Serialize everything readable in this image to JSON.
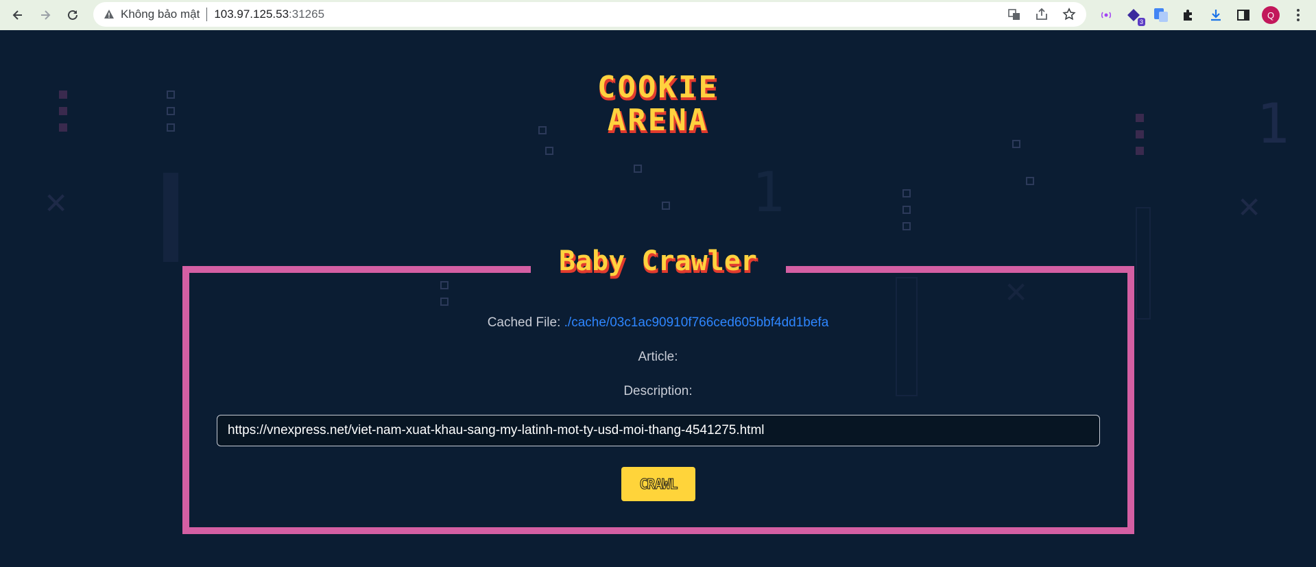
{
  "browser": {
    "security_label": "Không bảo mật",
    "url_host": "103.97.125.53",
    "url_port": ":31265",
    "extension_badge": "3",
    "profile_initial": "Q"
  },
  "page": {
    "logo_line1": "COOKIE",
    "logo_line2": "ARENA",
    "title": "Baby Crawler",
    "cached_file_label": "Cached File:",
    "cached_file_link": "./cache/03c1ac90910f766ced605bbf4dd1befa",
    "article_label": "Article:",
    "description_label": "Description:",
    "url_value": "https://vnexpress.net/viet-nam-xuat-khau-sang-my-latinh-mot-ty-usd-moi-thang-4541275.html",
    "crawl_button": "CRAWL"
  },
  "colors": {
    "background": "#0b1d33",
    "frame": "#d45fa3",
    "accent_yellow": "#ffd23f",
    "accent_red": "#e23b2e",
    "link": "#2e86ff"
  },
  "icons": [
    "back-arrow-icon",
    "forward-arrow-icon",
    "reload-icon",
    "warning-icon",
    "translate-icon",
    "share-icon",
    "star-icon",
    "cast-icon",
    "extension-icon",
    "google-translate-icon",
    "puzzle-icon",
    "download-icon",
    "side-panel-icon",
    "menu-dots-icon"
  ]
}
